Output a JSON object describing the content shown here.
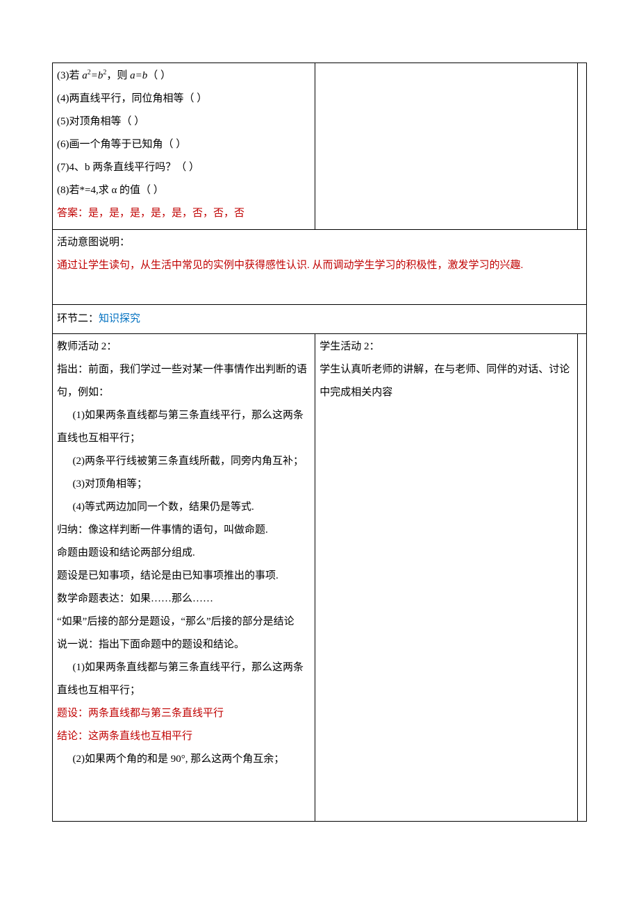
{
  "row1": {
    "q3_a": "(3)若 ",
    "q3_b": "a",
    "q3_c": "2",
    "q3_d": "=b",
    "q3_e": "2",
    "q3_f": "，则 ",
    "q3_g": "a=b",
    "q3_h": "（           ）",
    "q4": "(4)两直线平行，同位角相等（       ）",
    "q5": "(5)对顶角相等（       ）",
    "q6": "(6)画一个角等于已知角（       ）",
    "q7": "(7)4、b 两条直线平行吗？（       ）",
    "q8": "(8)若*=4,求 α 的值（           ）",
    "ans": "答案：是，是，是，是，是，否，否，否"
  },
  "row2": {
    "title": "活动意图说明：",
    "body": "通过让学生读句，从生活中常见的实例中获得感性认识. 从而调动学生学习的积极性，激发学习的兴趣."
  },
  "row3": {
    "lead": "环节二：",
    "title": "知识探究"
  },
  "left2": {
    "t_title": "教师活动 2：",
    "p1": "指出：前面，我们学过一些对某一件事情作出判断的语句，例如：",
    "i1": "(1)如果两条直线都与第三条直线平行，那么这两条直线也互相平行；",
    "i2": "(2)两条平行线被第三条直线所截，同旁内角互补；",
    "i3": "(3)对顶角相等；",
    "i4": "(4)等式两边加同一个数，结果仍是等式.",
    "p2": "归纳：像这样判断一件事情的语句，叫做命题.",
    "p3": "命题由题设和结论两部分组成.",
    "p4": "题设是已知事项，结论是由已知事项推出的事项.",
    "p5": "数学命题表达：如果……那么……",
    "p6": "“如果”后接的部分是题设，“那么”后接的部分是结论",
    "p7": "说一说：指出下面命题中的题设和结论。",
    "s1": "(1)如果两条直线都与第三条直线平行，那么这两条直线也互相平行；",
    "a1": "题设：两条直线都与第三条直线平行",
    "a2": "结论：这两条直线也互相平行",
    "s2": "(2)如果两个角的和是 90°, 那么这两个角互余；"
  },
  "right2": {
    "t_title": "学生活动 2：",
    "body": "学生认真听老师的讲解，在与老师、同伴的对话、讨论中完成相关内容"
  }
}
